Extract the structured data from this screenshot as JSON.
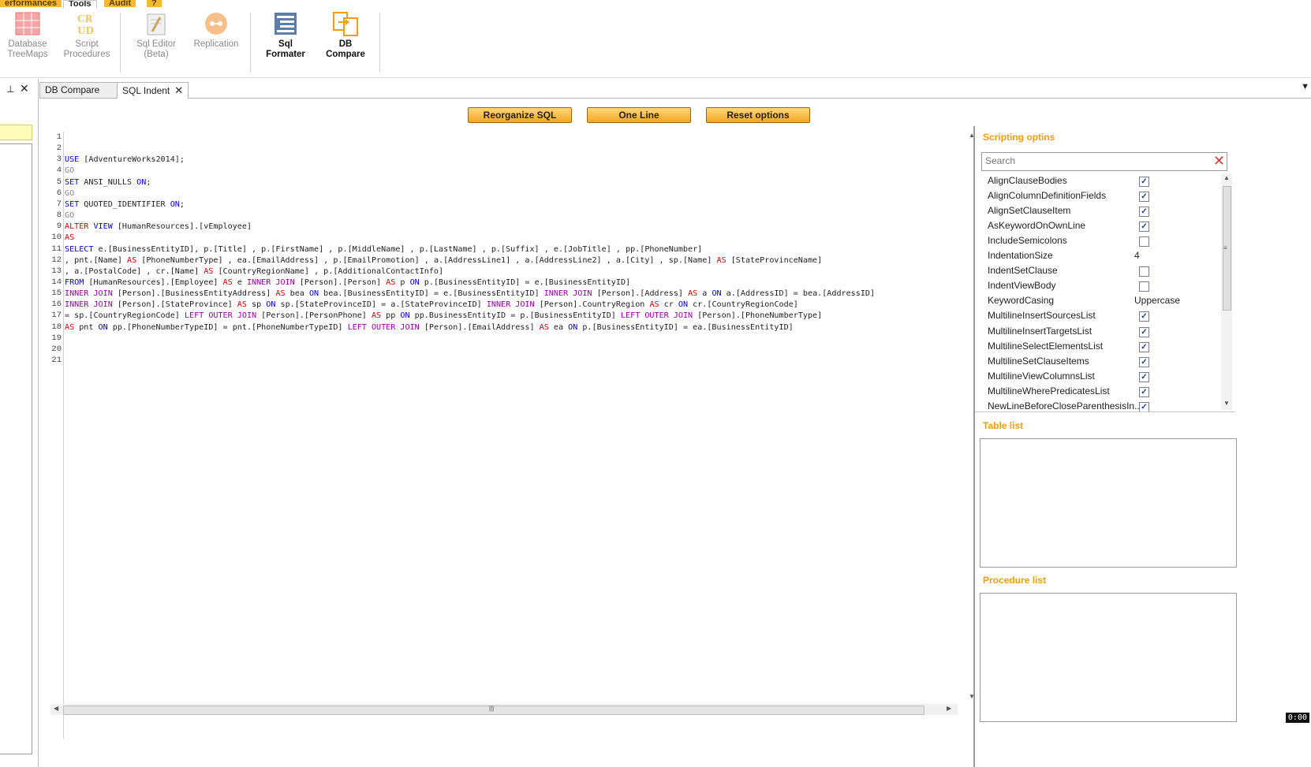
{
  "ribbon_tabs": [
    {
      "label": "erformances"
    },
    {
      "label": "Tools"
    },
    {
      "label": "Audit"
    },
    {
      "label": "?"
    }
  ],
  "ribbon": {
    "database_treemaps": "Database TreeMaps",
    "script_procedures": "Script Procedures",
    "sql_editor": "Sql Editor (Beta)",
    "replication": "Replication",
    "sql_formater": "Sql Formater",
    "db_compare": "DB Compare"
  },
  "doc_tabs": [
    {
      "label": "DB Compare"
    },
    {
      "label": "SQL Indent",
      "close": "✕"
    }
  ],
  "left_panel": {
    "pin": "⊥",
    "close": "✕"
  },
  "buttons": {
    "reorganize": "Reorganize SQL",
    "one_line": "One Line",
    "reset": "Reset options"
  },
  "editor": {
    "line_numbers": [
      "1",
      "2",
      "3",
      "4",
      "5",
      "6",
      "7",
      "8",
      "9",
      "10",
      "11",
      "12",
      "13",
      "14",
      "15",
      "16",
      "17",
      "18",
      "19",
      "20",
      "21"
    ],
    "lines": [
      [],
      [],
      [
        {
          "t": "USE",
          "c": "kw"
        },
        {
          "t": " [AdventureWorks2014];"
        }
      ],
      [
        {
          "t": "GO",
          "c": "gray"
        }
      ],
      [
        {
          "t": "SET",
          "c": "kw"
        },
        {
          "t": " ANSI_NULLS "
        },
        {
          "t": "ON",
          "c": "kw"
        },
        {
          "t": ";"
        }
      ],
      [
        {
          "t": "GO",
          "c": "gray"
        }
      ],
      [
        {
          "t": "SET",
          "c": "kw"
        },
        {
          "t": " QUOTED_IDENTIFIER "
        },
        {
          "t": "ON",
          "c": "kw"
        },
        {
          "t": ";"
        }
      ],
      [
        {
          "t": "GO",
          "c": "gray"
        }
      ],
      [
        {
          "t": "ALTER",
          "c": "red"
        },
        {
          "t": " "
        },
        {
          "t": "VIEW",
          "c": "kw"
        },
        {
          "t": " [HumanResources].[vEmployee]"
        }
      ],
      [
        {
          "t": "AS",
          "c": "red"
        }
      ],
      [
        {
          "t": "SELECT",
          "c": "kw"
        },
        {
          "t": " e.[BusinessEntityID], p.[Title] , p.[FirstName] , p.[MiddleName] , p.[LastName] , p.[Suffix] , e.[JobTitle] , pp.[PhoneNumber]"
        }
      ],
      [
        {
          "t": ", pnt.[Name] "
        },
        {
          "t": "AS",
          "c": "red"
        },
        {
          "t": " [PhoneNumberType] , ea.[EmailAddress] , p.[EmailPromotion] , a.[AddressLine1] , a.[AddressLine2] , a.[City] , sp.[Name] "
        },
        {
          "t": "AS",
          "c": "red"
        },
        {
          "t": " [StateProvinceName]"
        }
      ],
      [
        {
          "t": ", a.[PostalCode] , cr.[Name] "
        },
        {
          "t": "AS",
          "c": "red"
        },
        {
          "t": " [CountryRegionName] , p.[AdditionalContactInfo]"
        }
      ],
      [
        {
          "t": "FROM",
          "c": "kw"
        },
        {
          "t": " [HumanResources].[Employee] "
        },
        {
          "t": "AS",
          "c": "red"
        },
        {
          "t": " e "
        },
        {
          "t": "INNER JOIN",
          "c": "pur"
        },
        {
          "t": " [Person].[Person] "
        },
        {
          "t": "AS",
          "c": "red"
        },
        {
          "t": " p "
        },
        {
          "t": "ON",
          "c": "kw"
        },
        {
          "t": " p.[BusinessEntityID] = e.[BusinessEntityID]"
        }
      ],
      [
        {
          "t": "INNER JOIN",
          "c": "pur"
        },
        {
          "t": " [Person].[BusinessEntityAddress] "
        },
        {
          "t": "AS",
          "c": "red"
        },
        {
          "t": " bea "
        },
        {
          "t": "ON",
          "c": "kw"
        },
        {
          "t": " bea.[BusinessEntityID] = e.[BusinessEntityID] "
        },
        {
          "t": "INNER JOIN",
          "c": "pur"
        },
        {
          "t": " [Person].[Address] "
        },
        {
          "t": "AS",
          "c": "red"
        },
        {
          "t": " a "
        },
        {
          "t": "ON",
          "c": "kw"
        },
        {
          "t": " a.[AddressID] = bea.[AddressID]"
        }
      ],
      [
        {
          "t": "INNER JOIN",
          "c": "pur"
        },
        {
          "t": " [Person].[StateProvince] "
        },
        {
          "t": "AS",
          "c": "red"
        },
        {
          "t": " sp "
        },
        {
          "t": "ON",
          "c": "kw"
        },
        {
          "t": " sp.[StateProvinceID] = a.[StateProvinceID] "
        },
        {
          "t": "INNER JOIN",
          "c": "pur"
        },
        {
          "t": " [Person].CountryRegion "
        },
        {
          "t": "AS",
          "c": "red"
        },
        {
          "t": " cr "
        },
        {
          "t": "ON",
          "c": "kw"
        },
        {
          "t": " cr.[CountryRegionCode]"
        }
      ],
      [
        {
          "t": "= sp.[CountryRegionCode] "
        },
        {
          "t": "LEFT OUTER JOIN",
          "c": "pur"
        },
        {
          "t": " [Person].[PersonPhone] "
        },
        {
          "t": "AS",
          "c": "red"
        },
        {
          "t": " pp "
        },
        {
          "t": "ON",
          "c": "kw"
        },
        {
          "t": " pp.BusinessEntityID = p.[BusinessEntityID] "
        },
        {
          "t": "LEFT OUTER JOIN",
          "c": "pur"
        },
        {
          "t": " [Person].[PhoneNumberType]"
        }
      ],
      [
        {
          "t": "AS",
          "c": "red"
        },
        {
          "t": " pnt "
        },
        {
          "t": "ON",
          "c": "kw"
        },
        {
          "t": " pp.[PhoneNumberTypeID] = pnt.[PhoneNumberTypeID] "
        },
        {
          "t": "LEFT OUTER JOIN",
          "c": "pur"
        },
        {
          "t": " [Person].[EmailAddress] "
        },
        {
          "t": "AS",
          "c": "red"
        },
        {
          "t": " ea "
        },
        {
          "t": "ON",
          "c": "kw"
        },
        {
          "t": " p.[BusinessEntityID] = ea.[BusinessEntityID]"
        }
      ],
      [],
      [],
      []
    ]
  },
  "right_panel": {
    "scripting_title": "Scripting optins",
    "search_placeholder": "Search",
    "options": [
      {
        "name": "AlignClauseBodies",
        "type": "check",
        "checked": true
      },
      {
        "name": "AlignColumnDefinitionFields",
        "type": "check",
        "checked": true
      },
      {
        "name": "AlignSetClauseItem",
        "type": "check",
        "checked": true
      },
      {
        "name": "AsKeywordOnOwnLine",
        "type": "check",
        "checked": true
      },
      {
        "name": "IncludeSemicolons",
        "type": "check",
        "checked": false
      },
      {
        "name": "IndentationSize",
        "type": "value",
        "value": "4"
      },
      {
        "name": "IndentSetClause",
        "type": "check",
        "checked": false
      },
      {
        "name": "IndentViewBody",
        "type": "check",
        "checked": false
      },
      {
        "name": "KeywordCasing",
        "type": "select",
        "value": "Uppercase"
      },
      {
        "name": "MultilineInsertSourcesList",
        "type": "check",
        "checked": true
      },
      {
        "name": "MultilineInsertTargetsList",
        "type": "check",
        "checked": true
      },
      {
        "name": "MultilineSelectElementsList",
        "type": "check",
        "checked": true
      },
      {
        "name": "MultilineSetClauseItems",
        "type": "check",
        "checked": true
      },
      {
        "name": "MultilineViewColumnsList",
        "type": "check",
        "checked": true
      },
      {
        "name": "MultilineWherePredicatesList",
        "type": "check",
        "checked": true
      },
      {
        "name": "NewLineBeforeCloseParenthesisIn...",
        "type": "check",
        "checked": true
      }
    ],
    "table_list_title": "Table list",
    "procedure_list_title": "Procedure list"
  },
  "timer": "0:00"
}
